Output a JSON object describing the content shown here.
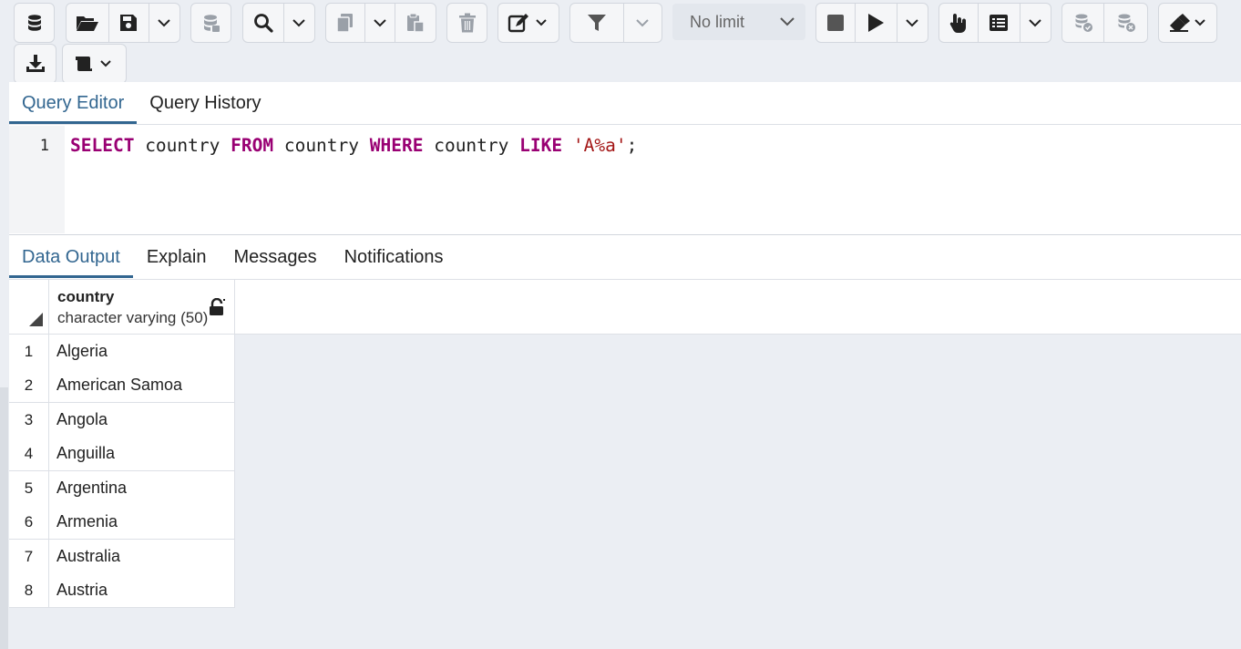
{
  "toolbar": {
    "limit_select": {
      "value": "No limit"
    },
    "icons": [
      "database-icon",
      "folder-open-icon",
      "save-icon",
      "chevron-down-icon",
      "database-stack-icon",
      "search-icon",
      "copy-icon",
      "paste-icon",
      "trash-icon",
      "edit-icon",
      "filter-icon",
      "stop-icon",
      "play-icon",
      "hand-pointer-icon",
      "list-icon",
      "commit-icon",
      "rollback-icon",
      "eraser-icon",
      "download-icon",
      "macro-icon"
    ]
  },
  "editor": {
    "tabs": [
      "Query Editor",
      "Query History"
    ],
    "active_tab": "Query Editor",
    "line_number": "1",
    "code_tokens": {
      "kw1": "SELECT",
      "t1": " country ",
      "kw2": "FROM",
      "t2": " country ",
      "kw3": "WHERE",
      "t3": " country ",
      "kw4": "LIKE",
      "t4": " ",
      "str1": "'A%a'",
      "t5": ";"
    }
  },
  "output": {
    "tabs": [
      "Data Output",
      "Explain",
      "Messages",
      "Notifications"
    ],
    "active_tab": "Data Output",
    "column": {
      "name": "country",
      "type": "character varying (50)"
    },
    "rows": [
      {
        "n": "1",
        "value": "Algeria"
      },
      {
        "n": "2",
        "value": "American Samoa"
      },
      {
        "n": "3",
        "value": "Angola"
      },
      {
        "n": "4",
        "value": "Anguilla"
      },
      {
        "n": "5",
        "value": "Argentina"
      },
      {
        "n": "6",
        "value": "Armenia"
      },
      {
        "n": "7",
        "value": "Australia"
      },
      {
        "n": "8",
        "value": "Austria"
      }
    ]
  },
  "colors": {
    "accent": "#326690",
    "keyword": "#990073",
    "string": "#a31515"
  }
}
